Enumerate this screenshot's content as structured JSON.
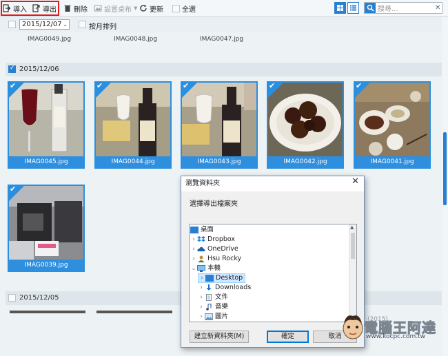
{
  "toolbar": {
    "import_label": "導入",
    "export_label": "導出",
    "delete_label": "刪除",
    "wallpaper_label": "設置桌布",
    "refresh_label": "更新",
    "select_all_label": "全選",
    "search_placeholder": "搜尋..."
  },
  "filter": {
    "date_value": "2015/12/07",
    "sort_label": "按月排列"
  },
  "top_files": [
    "IMAG0049.jpg",
    "IMAG0048.jpg",
    "IMAG0047.jpg"
  ],
  "groups": [
    {
      "date": "2015/12/06",
      "photos": [
        "IMAG0045.jpg",
        "IMAG0044.jpg",
        "IMAG0043.jpg",
        "IMAG0042.jpg",
        "IMAG0041.jpg",
        "IMAG0039.jpg"
      ]
    },
    {
      "date": "2015/12/05",
      "photos": []
    }
  ],
  "dialog": {
    "title": "瀏覽資料夾",
    "message": "選擇導出檔案夾",
    "tree": [
      "桌面",
      "Dropbox",
      "OneDrive",
      "Hsu Rocky",
      "本機",
      "Desktop",
      "Downloads",
      "文件",
      "音樂",
      "圖片"
    ],
    "new_folder_label": "建立新資料夾(M)",
    "ok_label": "確定",
    "cancel_label": "取消"
  },
  "watermark": {
    "name": "電腦王阿達",
    "url": "www.kocpc.com.tw",
    "faint": "(2015)"
  },
  "colors": {
    "accent": "#2b8fe0",
    "highlight_box": "#e0191f"
  }
}
